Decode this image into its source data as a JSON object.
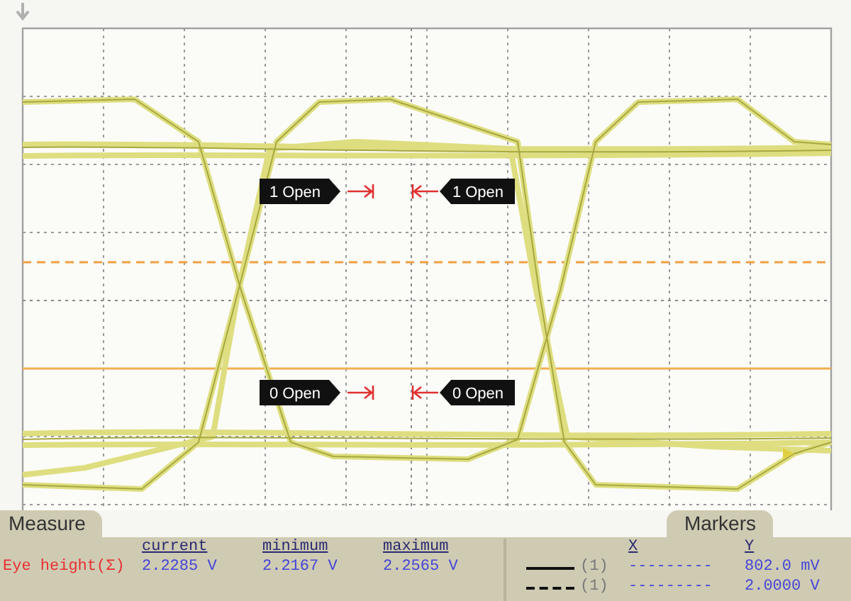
{
  "screen": {
    "open_labels": {
      "upper": {
        "left": "1 Open",
        "right": "1 Open"
      },
      "lower": {
        "left": "0 Open",
        "right": "0 Open"
      }
    }
  },
  "measure": {
    "tab": "Measure",
    "columns": [
      "current",
      "minimum",
      "maximum"
    ],
    "rows": [
      {
        "name": "Eye height(Σ)",
        "values": [
          "2.2285 V",
          "2.2167 V",
          "2.2565 V"
        ]
      }
    ]
  },
  "markers": {
    "tab": "Markers",
    "columns": [
      "X",
      "Y"
    ],
    "rows": [
      {
        "kind": "solid",
        "source": "(1)",
        "x": "---------",
        "y": "802.0 mV"
      },
      {
        "kind": "dashed",
        "source": "(1)",
        "x": "---------",
        "y": "2.0000 V"
      }
    ]
  }
}
